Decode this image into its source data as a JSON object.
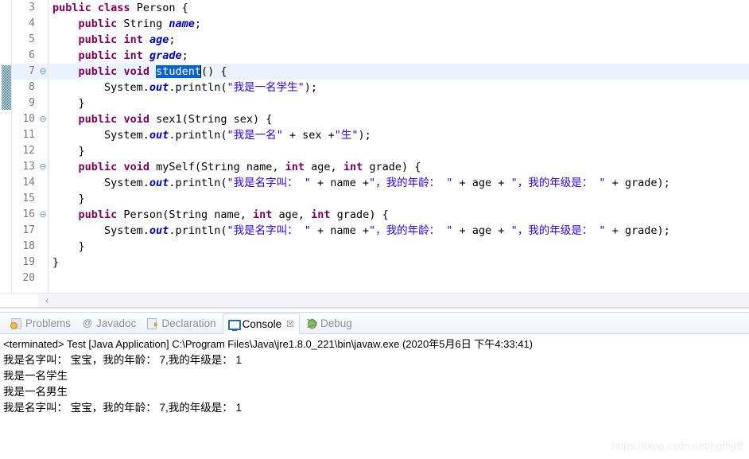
{
  "editor": {
    "first_line_number": 3,
    "highlighted_line": 7,
    "selection_text": "student",
    "marker_bar_range": [
      7,
      9
    ],
    "fold_lines": [
      7,
      10,
      13,
      16
    ],
    "scroll_left_arrow": "‹",
    "lines": [
      {
        "num": "3",
        "fold": "",
        "segs": [
          {
            "t": "public",
            "c": "kw"
          },
          {
            "t": " ",
            "c": "plain"
          },
          {
            "t": "class",
            "c": "kw"
          },
          {
            "t": " Person {",
            "c": "plain"
          }
        ]
      },
      {
        "num": "4",
        "fold": "",
        "segs": [
          {
            "t": "    ",
            "c": "plain"
          },
          {
            "t": "public",
            "c": "kw"
          },
          {
            "t": " String ",
            "c": "plain"
          },
          {
            "t": "name",
            "c": "fld"
          },
          {
            "t": ";",
            "c": "plain"
          }
        ]
      },
      {
        "num": "5",
        "fold": "",
        "segs": [
          {
            "t": "    ",
            "c": "plain"
          },
          {
            "t": "public",
            "c": "kw"
          },
          {
            "t": " ",
            "c": "plain"
          },
          {
            "t": "int",
            "c": "kw"
          },
          {
            "t": " ",
            "c": "plain"
          },
          {
            "t": "age",
            "c": "fld"
          },
          {
            "t": ";",
            "c": "plain"
          }
        ]
      },
      {
        "num": "6",
        "fold": "",
        "segs": [
          {
            "t": "    ",
            "c": "plain"
          },
          {
            "t": "public",
            "c": "kw"
          },
          {
            "t": " ",
            "c": "plain"
          },
          {
            "t": "int",
            "c": "kw"
          },
          {
            "t": " ",
            "c": "plain"
          },
          {
            "t": "grade",
            "c": "fld"
          },
          {
            "t": ";",
            "c": "plain"
          }
        ]
      },
      {
        "num": "7",
        "fold": "⊖",
        "hl": true,
        "segs": [
          {
            "t": "    ",
            "c": "plain"
          },
          {
            "t": "public",
            "c": "kw"
          },
          {
            "t": " ",
            "c": "plain"
          },
          {
            "t": "void",
            "c": "kw"
          },
          {
            "t": " ",
            "c": "plain"
          },
          {
            "t": "student",
            "c": "sel"
          },
          {
            "t": "",
            "c": "caret"
          },
          {
            "t": "() {",
            "c": "plain"
          }
        ]
      },
      {
        "num": "8",
        "fold": "",
        "segs": [
          {
            "t": "        System.",
            "c": "plain"
          },
          {
            "t": "out",
            "c": "fld"
          },
          {
            "t": ".println(",
            "c": "plain"
          },
          {
            "t": "\"我是一名学生\"",
            "c": "str"
          },
          {
            "t": ");",
            "c": "plain"
          }
        ]
      },
      {
        "num": "9",
        "fold": "",
        "segs": [
          {
            "t": "    }",
            "c": "plain"
          }
        ]
      },
      {
        "num": "10",
        "fold": "⊖",
        "segs": [
          {
            "t": "    ",
            "c": "plain"
          },
          {
            "t": "public",
            "c": "kw"
          },
          {
            "t": " ",
            "c": "plain"
          },
          {
            "t": "void",
            "c": "kw"
          },
          {
            "t": " sex1(String sex) {",
            "c": "plain"
          }
        ]
      },
      {
        "num": "11",
        "fold": "",
        "segs": [
          {
            "t": "        System.",
            "c": "plain"
          },
          {
            "t": "out",
            "c": "fld"
          },
          {
            "t": ".println(",
            "c": "plain"
          },
          {
            "t": "\"我是一名\"",
            "c": "str"
          },
          {
            "t": " + sex +",
            "c": "plain"
          },
          {
            "t": "\"生\"",
            "c": "str"
          },
          {
            "t": ");",
            "c": "plain"
          }
        ]
      },
      {
        "num": "12",
        "fold": "",
        "segs": [
          {
            "t": "    }",
            "c": "plain"
          }
        ]
      },
      {
        "num": "13",
        "fold": "⊖",
        "segs": [
          {
            "t": "    ",
            "c": "plain"
          },
          {
            "t": "public",
            "c": "kw"
          },
          {
            "t": " ",
            "c": "plain"
          },
          {
            "t": "void",
            "c": "kw"
          },
          {
            "t": " mySelf(String name, ",
            "c": "plain"
          },
          {
            "t": "int",
            "c": "kw"
          },
          {
            "t": " age, ",
            "c": "plain"
          },
          {
            "t": "int",
            "c": "kw"
          },
          {
            "t": " grade) {",
            "c": "plain"
          }
        ]
      },
      {
        "num": "14",
        "fold": "",
        "segs": [
          {
            "t": "        System.",
            "c": "plain"
          },
          {
            "t": "out",
            "c": "fld"
          },
          {
            "t": ".println(",
            "c": "plain"
          },
          {
            "t": "\"我是名字叫： \"",
            "c": "str"
          },
          {
            "t": " + name +",
            "c": "plain"
          },
          {
            "t": "\"，我的年龄： \"",
            "c": "str"
          },
          {
            "t": " + age + ",
            "c": "plain"
          },
          {
            "t": "\"，我的年级是： \"",
            "c": "str"
          },
          {
            "t": " + grade);",
            "c": "plain"
          }
        ]
      },
      {
        "num": "15",
        "fold": "",
        "segs": [
          {
            "t": "    }",
            "c": "plain"
          }
        ]
      },
      {
        "num": "16",
        "fold": "⊖",
        "segs": [
          {
            "t": "    ",
            "c": "plain"
          },
          {
            "t": "public",
            "c": "kw"
          },
          {
            "t": " Person(String name, ",
            "c": "plain"
          },
          {
            "t": "int",
            "c": "kw"
          },
          {
            "t": " age, ",
            "c": "plain"
          },
          {
            "t": "int",
            "c": "kw"
          },
          {
            "t": " grade) {",
            "c": "plain"
          }
        ]
      },
      {
        "num": "17",
        "fold": "",
        "segs": [
          {
            "t": "        System.",
            "c": "plain"
          },
          {
            "t": "out",
            "c": "fld"
          },
          {
            "t": ".println(",
            "c": "plain"
          },
          {
            "t": "\"我是名字叫： \"",
            "c": "str"
          },
          {
            "t": " + name +",
            "c": "plain"
          },
          {
            "t": "\"，我的年龄： \"",
            "c": "str"
          },
          {
            "t": " + age + ",
            "c": "plain"
          },
          {
            "t": "\"，我的年级是： \"",
            "c": "str"
          },
          {
            "t": " + grade);",
            "c": "plain"
          }
        ]
      },
      {
        "num": "18",
        "fold": "",
        "segs": [
          {
            "t": "    }",
            "c": "plain"
          }
        ]
      },
      {
        "num": "19",
        "fold": "",
        "segs": [
          {
            "t": "}",
            "c": "plain"
          }
        ]
      },
      {
        "num": "20",
        "fold": "",
        "segs": []
      }
    ]
  },
  "panel": {
    "tabs": [
      {
        "label": "Problems",
        "icon": "problems-icon",
        "active": false,
        "closable": false
      },
      {
        "label": "Javadoc",
        "icon": "javadoc-icon",
        "active": false,
        "closable": false
      },
      {
        "label": "Declaration",
        "icon": "declaration-icon",
        "active": false,
        "closable": false
      },
      {
        "label": "Console",
        "icon": "console-icon",
        "active": true,
        "closable": true,
        "close_glyph": "☒"
      },
      {
        "label": "Debug",
        "icon": "debug-icon",
        "active": false,
        "closable": false
      }
    ],
    "console": {
      "terminated_line": "<terminated> Test [Java Application] C:\\Program Files\\Java\\jre1.8.0_221\\bin\\javaw.exe (2020年5月6日 下午4:33:41)",
      "output_lines": [
        "我是名字叫： 宝宝，我的年龄： 7,我的年级是： 1",
        "我是一名学生",
        "我是一名男生",
        "我是名字叫： 宝宝，我的年龄： 7,我的年级是： 1"
      ]
    }
  },
  "watermark": {
    "text": "https://blog.csdn.net/hgfhjtff"
  },
  "colors": {
    "keyword": "#7f0055",
    "string": "#2a00ff",
    "field": "#0000c0",
    "selection": "#0a64c8",
    "current_line": "#eaf2fb",
    "marker_bar": "#2f73ba",
    "gutter_text": "#7a7a84"
  }
}
